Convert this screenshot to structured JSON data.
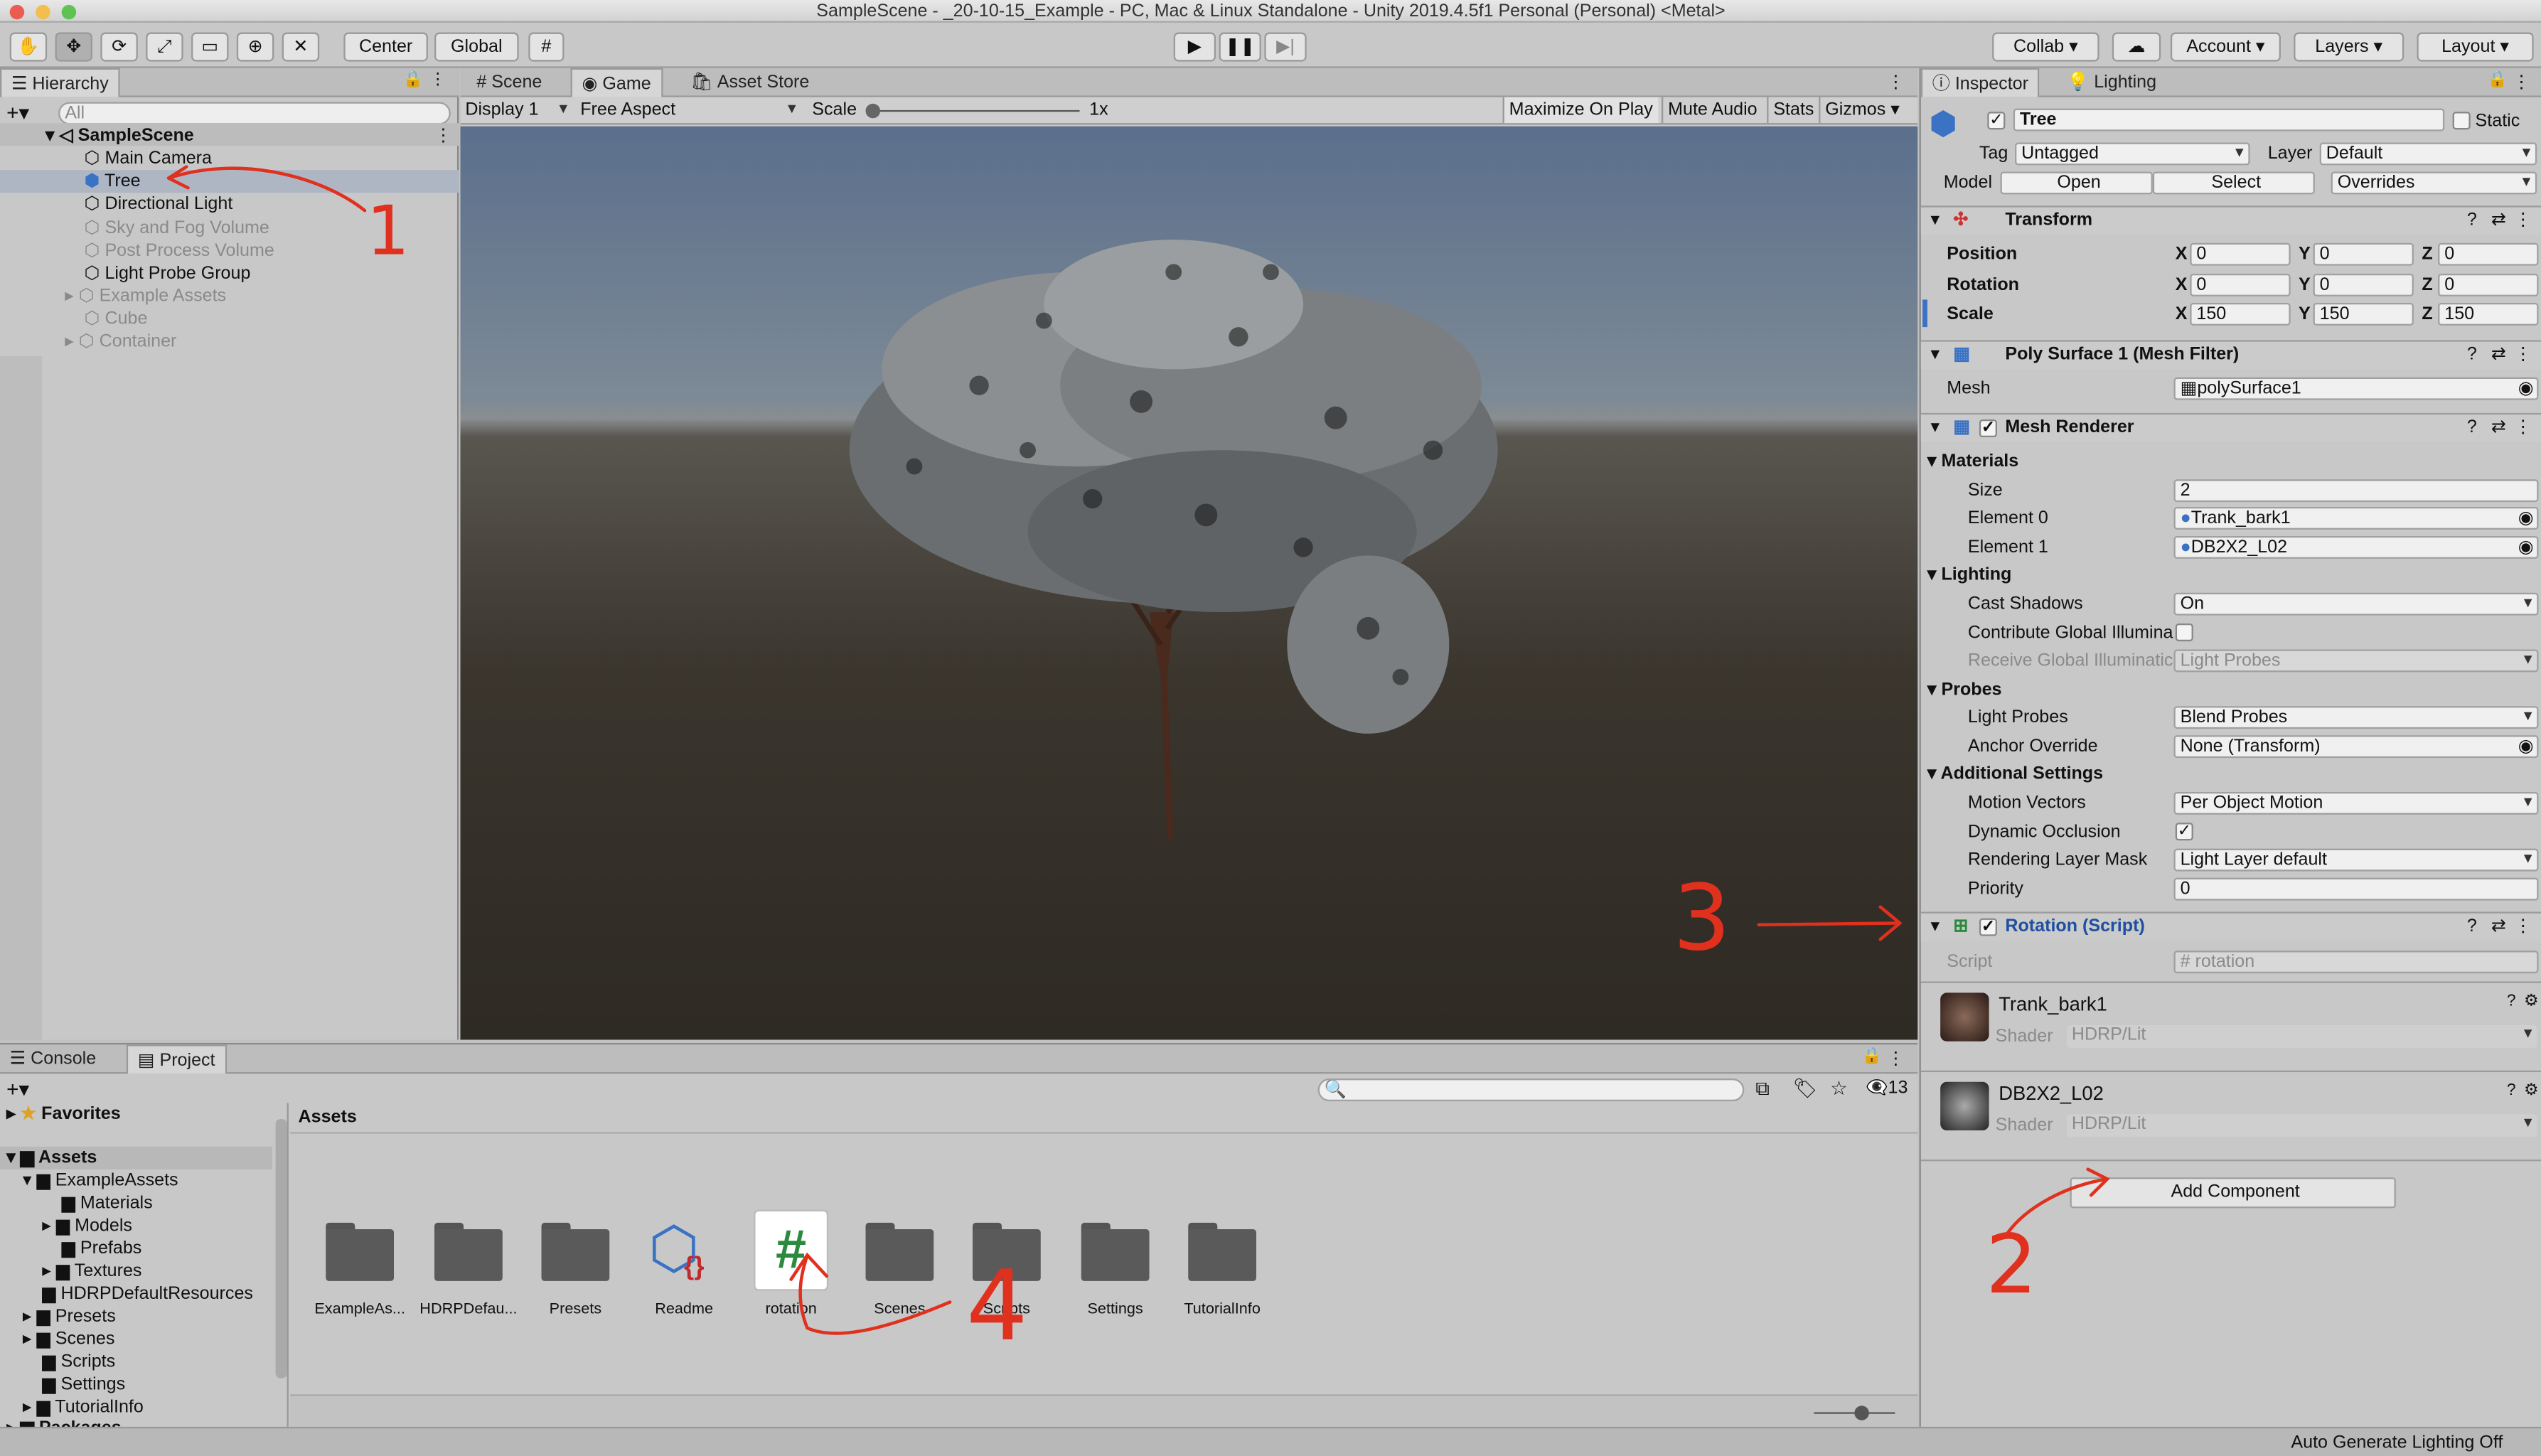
{
  "window": {
    "title": "SampleScene - _20-10-15_Example - PC, Mac & Linux Standalone - Unity 2019.4.5f1 Personal (Personal) <Metal>"
  },
  "toolbar": {
    "center": "Center",
    "global": "Global",
    "collab": "Collab",
    "account": "Account",
    "layers": "Layers",
    "layout": "Layout"
  },
  "hierarchy": {
    "tab": "Hierarchy",
    "search_placeholder": "All",
    "scene": "SampleScene",
    "items": [
      "Main Camera",
      "Tree",
      "Directional Light",
      "Sky and Fog Volume",
      "Post Process Volume",
      "Light Probe Group",
      "Example Assets",
      "Cube",
      "Container"
    ]
  },
  "center_tabs": {
    "scene": "Scene",
    "game": "Game",
    "asset_store": "Asset Store"
  },
  "game_bar": {
    "display": "Display 1",
    "aspect": "Free Aspect",
    "scale_label": "Scale",
    "scale_value": "1x",
    "maximize": "Maximize On Play",
    "mute": "Mute Audio",
    "stats": "Stats",
    "gizmos": "Gizmos"
  },
  "inspector": {
    "tab": "Inspector",
    "lighting_tab": "Lighting",
    "object_name": "Tree",
    "static": "Static",
    "tag_label": "Tag",
    "tag": "Untagged",
    "layer_label": "Layer",
    "layer": "Default",
    "model_label": "Model",
    "open": "Open",
    "select": "Select",
    "overrides": "Overrides",
    "transform": {
      "title": "Transform",
      "position": "Position",
      "rotation": "Rotation",
      "scale": "Scale",
      "pos": [
        "0",
        "0",
        "0"
      ],
      "rot": [
        "0",
        "0",
        "0"
      ],
      "scl": [
        "150",
        "150",
        "150"
      ]
    },
    "mesh_filter": {
      "title": "Poly Surface 1 (Mesh Filter)",
      "mesh_label": "Mesh",
      "mesh": "polySurface1"
    },
    "mesh_renderer": {
      "title": "Mesh Renderer",
      "materials": "Materials",
      "size_label": "Size",
      "size": "2",
      "el0_label": "Element 0",
      "el0": "Trank_bark1",
      "el1_label": "Element 1",
      "el1": "DB2X2_L02",
      "lighting": "Lighting",
      "cast_label": "Cast Shadows",
      "cast": "On",
      "contrib_label": "Contribute Global Illumina",
      "receive_label": "Receive Global Illuminatic",
      "receive": "Light Probes",
      "probes": "Probes",
      "lp_label": "Light Probes",
      "lp": "Blend Probes",
      "anchor_label": "Anchor Override",
      "anchor": "None (Transform)",
      "additional": "Additional Settings",
      "mv_label": "Motion Vectors",
      "mv": "Per Object Motion",
      "occ_label": "Dynamic Occlusion",
      "rlm_label": "Rendering Layer Mask",
      "rlm": "Light Layer default",
      "prio_label": "Priority",
      "prio": "0"
    },
    "rotation_script": {
      "title": "Rotation (Script)",
      "script_label": "Script",
      "script": "rotation"
    },
    "mat1": {
      "name": "Trank_bark1",
      "shader_label": "Shader",
      "shader": "HDRP/Lit"
    },
    "mat2": {
      "name": "DB2X2_L02",
      "shader_label": "Shader",
      "shader": "HDRP/Lit"
    },
    "add_component": "Add Component"
  },
  "bottom_tabs": {
    "console": "Console",
    "project": "Project",
    "hidden_count": "13"
  },
  "project": {
    "favorites": "Favorites",
    "assets": "Assets",
    "breadcrumb": "Assets",
    "tree": [
      "ExampleAssets",
      "Materials",
      "Models",
      "Prefabs",
      "Textures",
      "HDRPDefaultResources",
      "Presets",
      "Scenes",
      "Scripts",
      "Settings",
      "TutorialInfo",
      "Packages"
    ],
    "grid": [
      "ExampleAs...",
      "HDRPDefau...",
      "Presets",
      "Readme",
      "rotation",
      "Scenes",
      "Scripts",
      "Settings",
      "TutorialInfo"
    ]
  },
  "status": {
    "text": "Auto Generate Lighting Off"
  },
  "annotations": [
    "1",
    "2",
    "3",
    "4"
  ],
  "colors": {
    "accent": "#3a72c4",
    "annotation": "#e0301e",
    "sky_top": "#5b6f8c",
    "ground": "#3a352d"
  }
}
